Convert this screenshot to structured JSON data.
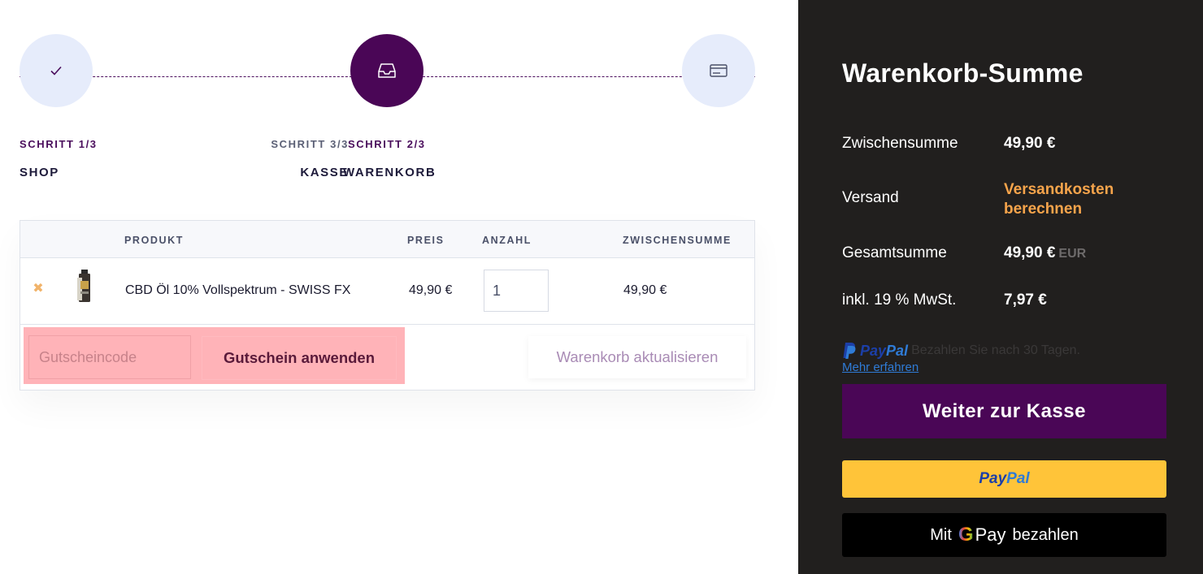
{
  "steps": [
    {
      "small": "SCHRITT 1/3",
      "label": "SHOP",
      "icon": "check-icon"
    },
    {
      "small": "SCHRITT 2/3",
      "label": "WARENKORB",
      "icon": "inbox-tray-icon"
    },
    {
      "small": "SCHRITT 3/3",
      "label": "KASSE",
      "icon": "credit-card-icon"
    }
  ],
  "cart": {
    "headers": {
      "product": "PRODUKT",
      "price": "PREIS",
      "qty": "ANZAHL",
      "subtotal": "ZWISCHENSUMME"
    },
    "items": [
      {
        "name": "CBD Öl 10% Vollspektrum - SWISS FX",
        "price": "49,90 €",
        "qty": "1",
        "subtotal": "49,90 €"
      }
    ],
    "coupon_placeholder": "Gutscheincode",
    "coupon_button": "Gutschein anwenden",
    "update_button": "Warenkorb aktualisieren"
  },
  "summary": {
    "title": "Warenkorb-Summe",
    "subtotal_label": "Zwischensumme",
    "subtotal_value": "49,90 €",
    "shipping_label": "Versand",
    "shipping_value": "Versandkosten berechnen",
    "total_label": "Gesamtsumme",
    "total_value": "49,90 €",
    "total_currency": "EUR",
    "tax_label": "inkl. 19 % MwSt.",
    "tax_value": "7,97 €",
    "paypal_word_a": "Pay",
    "paypal_word_b": "Pal",
    "paypal_message": "Bezahlen Sie nach 30 Tagen.",
    "learn_more": "Mehr erfahren",
    "checkout_button": "Weiter zur Kasse",
    "gpay_prefix": "Mit",
    "gpay_g": "G",
    "gpay_pay": "Pay",
    "gpay_suffix": "bezahlen"
  },
  "colors": {
    "accent_purple": "#4a0656",
    "shipping_orange": "#f6a44b",
    "panel_dark": "#211f1e",
    "coupon_highlight": "#ffb3b8",
    "paypal_yellow": "#ffc439"
  }
}
